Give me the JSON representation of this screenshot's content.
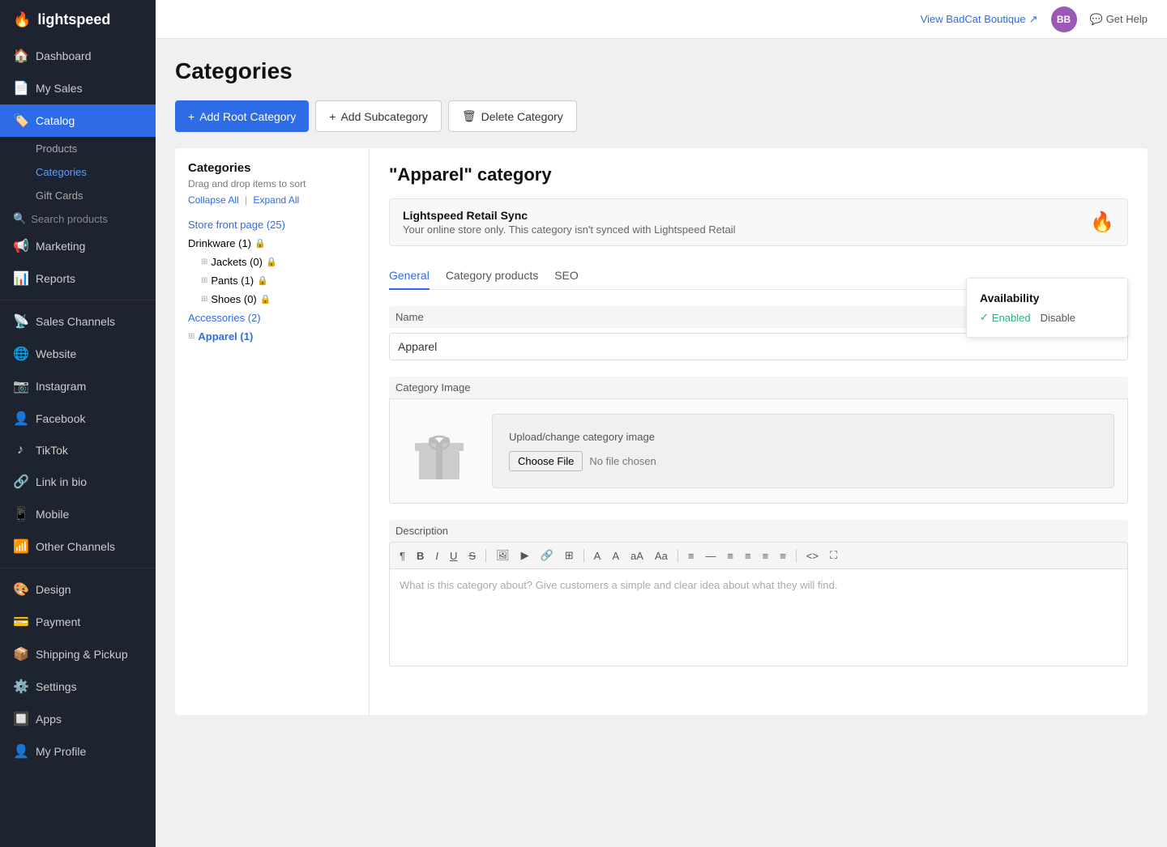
{
  "brand": {
    "name": "lightspeed",
    "flame": "🔥"
  },
  "topbar": {
    "store_link": "View BadCat Boutique",
    "avatar_initials": "BB",
    "help_label": "Get Help"
  },
  "sidebar": {
    "nav_items": [
      {
        "id": "dashboard",
        "icon": "🏠",
        "label": "Dashboard"
      },
      {
        "id": "my-sales",
        "icon": "📄",
        "label": "My Sales"
      },
      {
        "id": "catalog",
        "icon": "🏷️",
        "label": "Catalog",
        "active": true
      }
    ],
    "catalog_sub": [
      {
        "id": "products",
        "label": "Products"
      },
      {
        "id": "categories",
        "label": "Categories",
        "active": true
      },
      {
        "id": "gift-cards",
        "label": "Gift Cards"
      }
    ],
    "search_placeholder": "Search products",
    "mid_items": [
      {
        "id": "marketing",
        "icon": "📢",
        "label": "Marketing"
      },
      {
        "id": "reports",
        "icon": "📊",
        "label": "Reports"
      }
    ],
    "channel_items": [
      {
        "id": "sales-channels",
        "icon": "📡",
        "label": "Sales Channels"
      },
      {
        "id": "website",
        "icon": "🌐",
        "label": "Website"
      },
      {
        "id": "instagram",
        "icon": "📷",
        "label": "Instagram"
      },
      {
        "id": "facebook",
        "icon": "👤",
        "label": "Facebook"
      },
      {
        "id": "tiktok",
        "icon": "♪",
        "label": "TikTok"
      },
      {
        "id": "link-in-bio",
        "icon": "🔗",
        "label": "Link in bio"
      },
      {
        "id": "mobile",
        "icon": "📱",
        "label": "Mobile"
      },
      {
        "id": "other-channels",
        "icon": "📶",
        "label": "Other Channels"
      }
    ],
    "bottom_items": [
      {
        "id": "design",
        "icon": "🎨",
        "label": "Design"
      },
      {
        "id": "payment",
        "icon": "💳",
        "label": "Payment"
      },
      {
        "id": "shipping",
        "icon": "📦",
        "label": "Shipping & Pickup"
      },
      {
        "id": "settings",
        "icon": "⚙️",
        "label": "Settings"
      },
      {
        "id": "apps",
        "icon": "🔲",
        "label": "Apps"
      },
      {
        "id": "my-profile",
        "icon": "👤",
        "label": "My Profile"
      }
    ]
  },
  "page": {
    "title": "Categories",
    "actions": {
      "add_root": "Add Root Category",
      "add_sub": "Add Subcategory",
      "delete": "Delete Category"
    }
  },
  "category_tree": {
    "heading": "Categories",
    "drag_hint": "Drag and drop items to sort",
    "collapse_all": "Collapse All",
    "expand_all": "Expand All",
    "items": [
      {
        "id": "storefront",
        "label": "Store front page (25)",
        "link": true,
        "indent": 0
      },
      {
        "id": "drinkware",
        "label": "Drinkware (1)",
        "link": false,
        "lock": true,
        "indent": 0
      },
      {
        "id": "jackets",
        "label": "Jackets (0)",
        "link": false,
        "lock": true,
        "indent": 1,
        "expand": true
      },
      {
        "id": "pants",
        "label": "Pants (1)",
        "link": false,
        "lock": true,
        "indent": 1,
        "expand": true
      },
      {
        "id": "shoes",
        "label": "Shoes (0)",
        "link": false,
        "lock": true,
        "indent": 1,
        "expand": true
      },
      {
        "id": "accessories",
        "label": "Accessories (2)",
        "link": true,
        "indent": 0
      },
      {
        "id": "apparel",
        "label": "Apparel (1)",
        "link": true,
        "active": true,
        "indent": 0,
        "expand": true
      }
    ]
  },
  "category_detail": {
    "title": "\"Apparel\" category",
    "sync": {
      "title": "Lightspeed Retail Sync",
      "description": "Your online store only. This category isn't synced with Lightspeed Retail"
    },
    "tabs": [
      "General",
      "Category products",
      "SEO"
    ],
    "active_tab": "General",
    "name_label": "Name",
    "name_value": "Apparel",
    "availability": {
      "label": "Availability",
      "enabled": "Enabled",
      "disable": "Disable"
    },
    "category_image_label": "Category Image",
    "upload_text": "Upload/change category image",
    "choose_file_btn": "Choose File",
    "no_file_text": "No file chosen",
    "description_label": "Description",
    "description_placeholder": "What is this category about? Give customers a simple and clear idea about what they will find.",
    "toolbar_buttons": [
      "¶",
      "B",
      "I",
      "U",
      "S",
      "🖼",
      "▶",
      "🔗",
      "⊞",
      "A",
      "A",
      "aA",
      "Aa",
      "≡",
      "—",
      "≡",
      "≡",
      "≡",
      "≡",
      "<>",
      "⛶"
    ]
  }
}
